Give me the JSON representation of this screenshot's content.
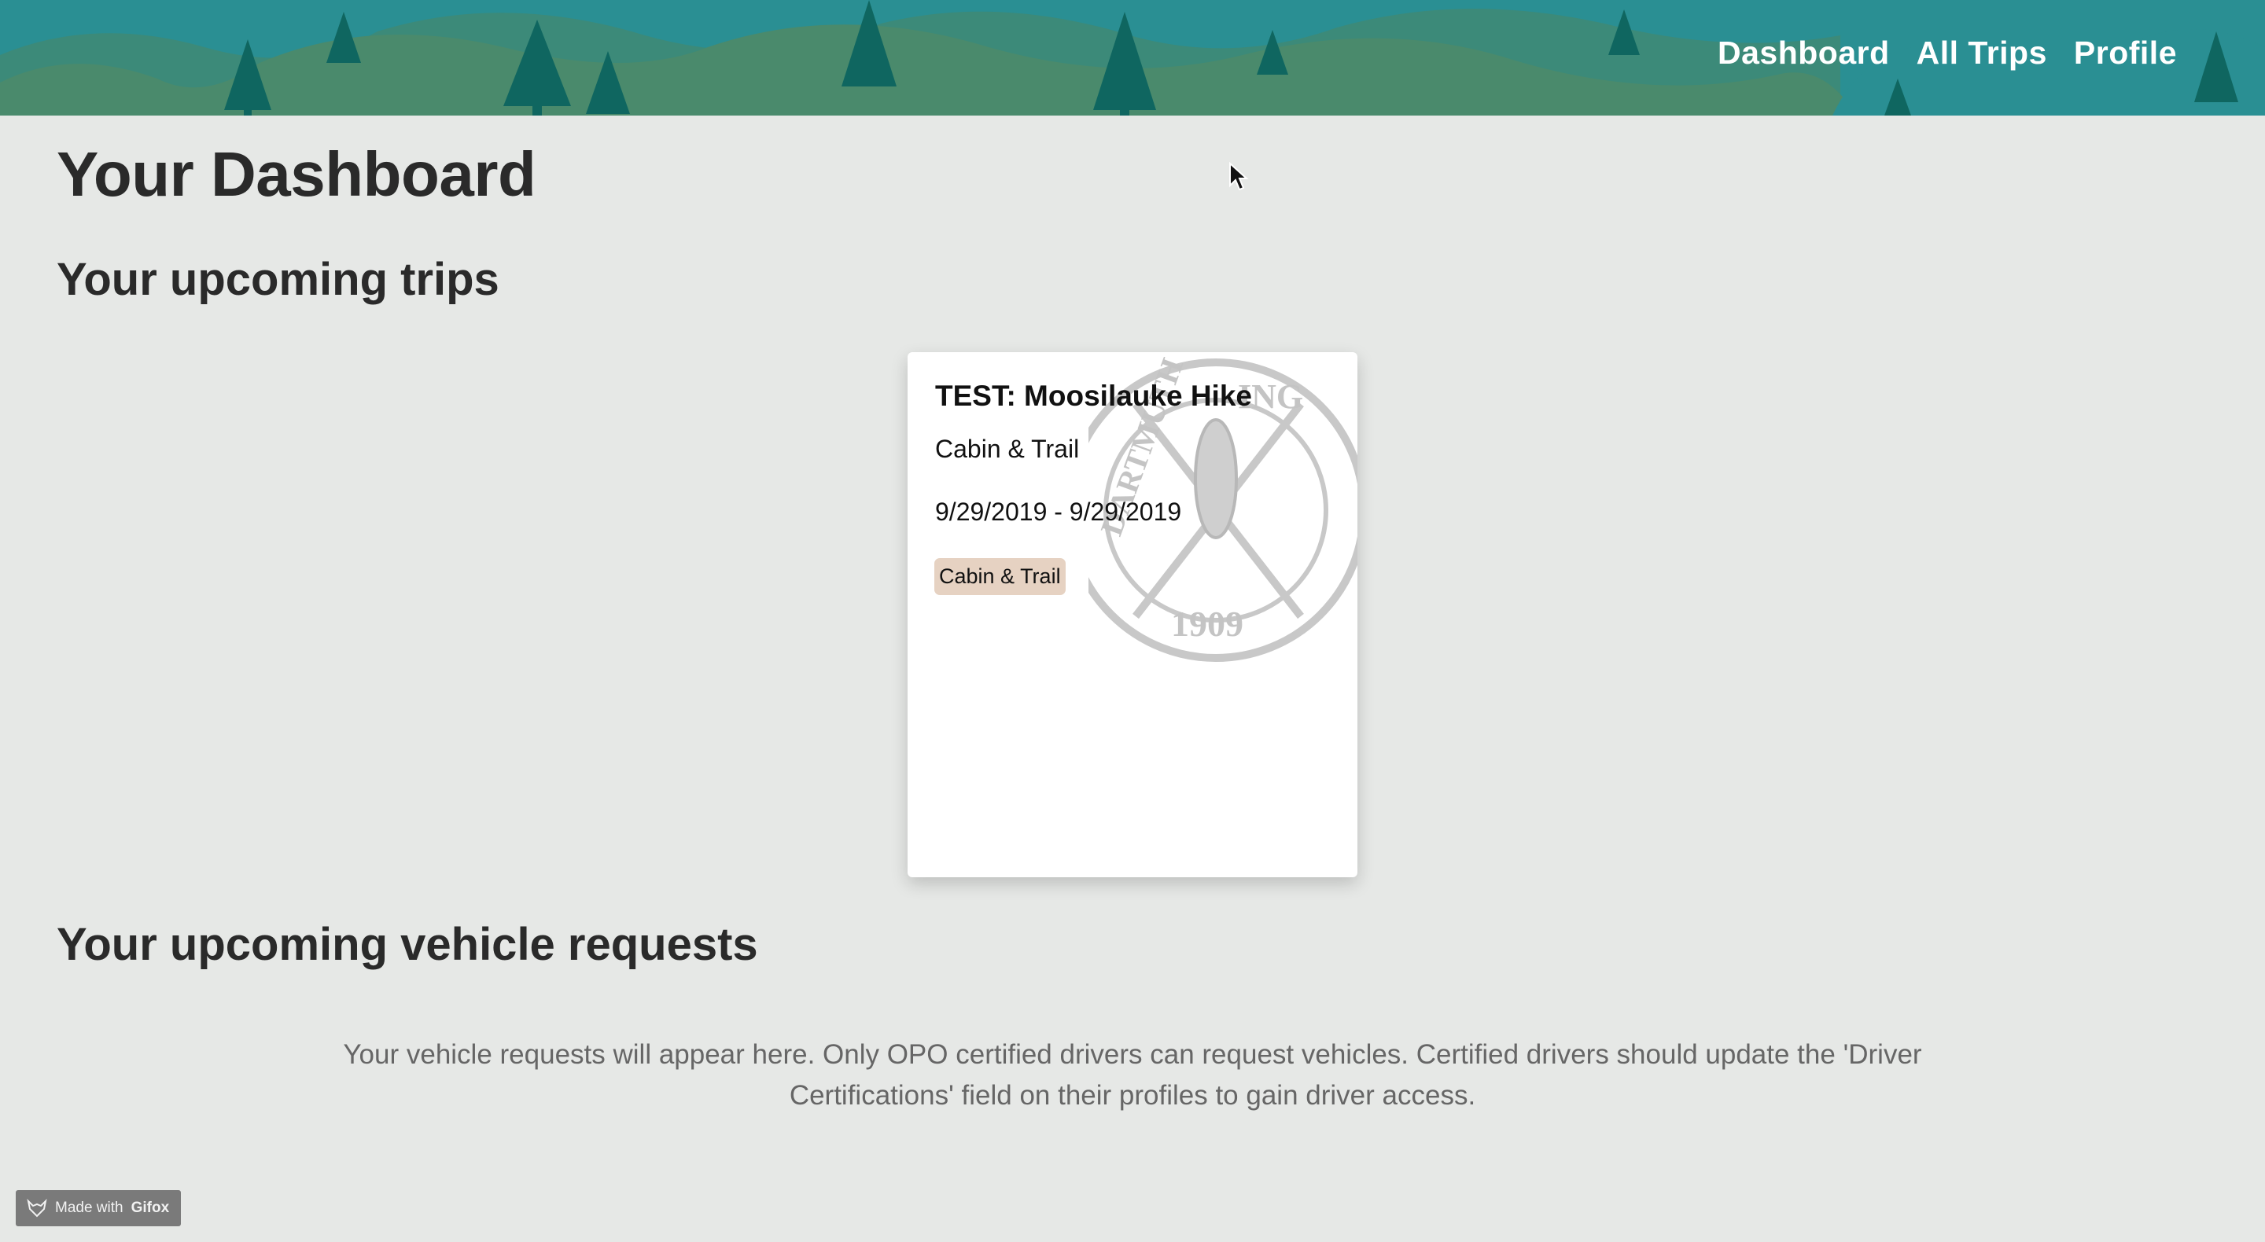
{
  "nav": {
    "items": [
      {
        "label": "Dashboard"
      },
      {
        "label": "All Trips"
      },
      {
        "label": "Profile"
      }
    ]
  },
  "page": {
    "title": "Your Dashboard"
  },
  "trips_section": {
    "heading": "Your upcoming trips",
    "cards": [
      {
        "title": "TEST: Moosilauke Hike",
        "club": "Cabin & Trail",
        "dates": "9/29/2019 - 9/29/2019",
        "tag": "Cabin & Trail"
      }
    ]
  },
  "vehicles_section": {
    "heading": "Your upcoming vehicle requests",
    "empty_message": "Your vehicle requests will appear here. Only OPO certified drivers can request vehicles. Certified drivers should update the 'Driver Certifications' field on their profiles to gain driver access."
  },
  "watermark": {
    "prefix": "Made with",
    "brand": "Gifox"
  },
  "colors": {
    "header_teal": "#2a8f93",
    "hills_green": "#46896e",
    "tree_dark": "#0f6660",
    "tag_bg": "#e6d2c2",
    "page_bg": "#e6e8e6"
  }
}
